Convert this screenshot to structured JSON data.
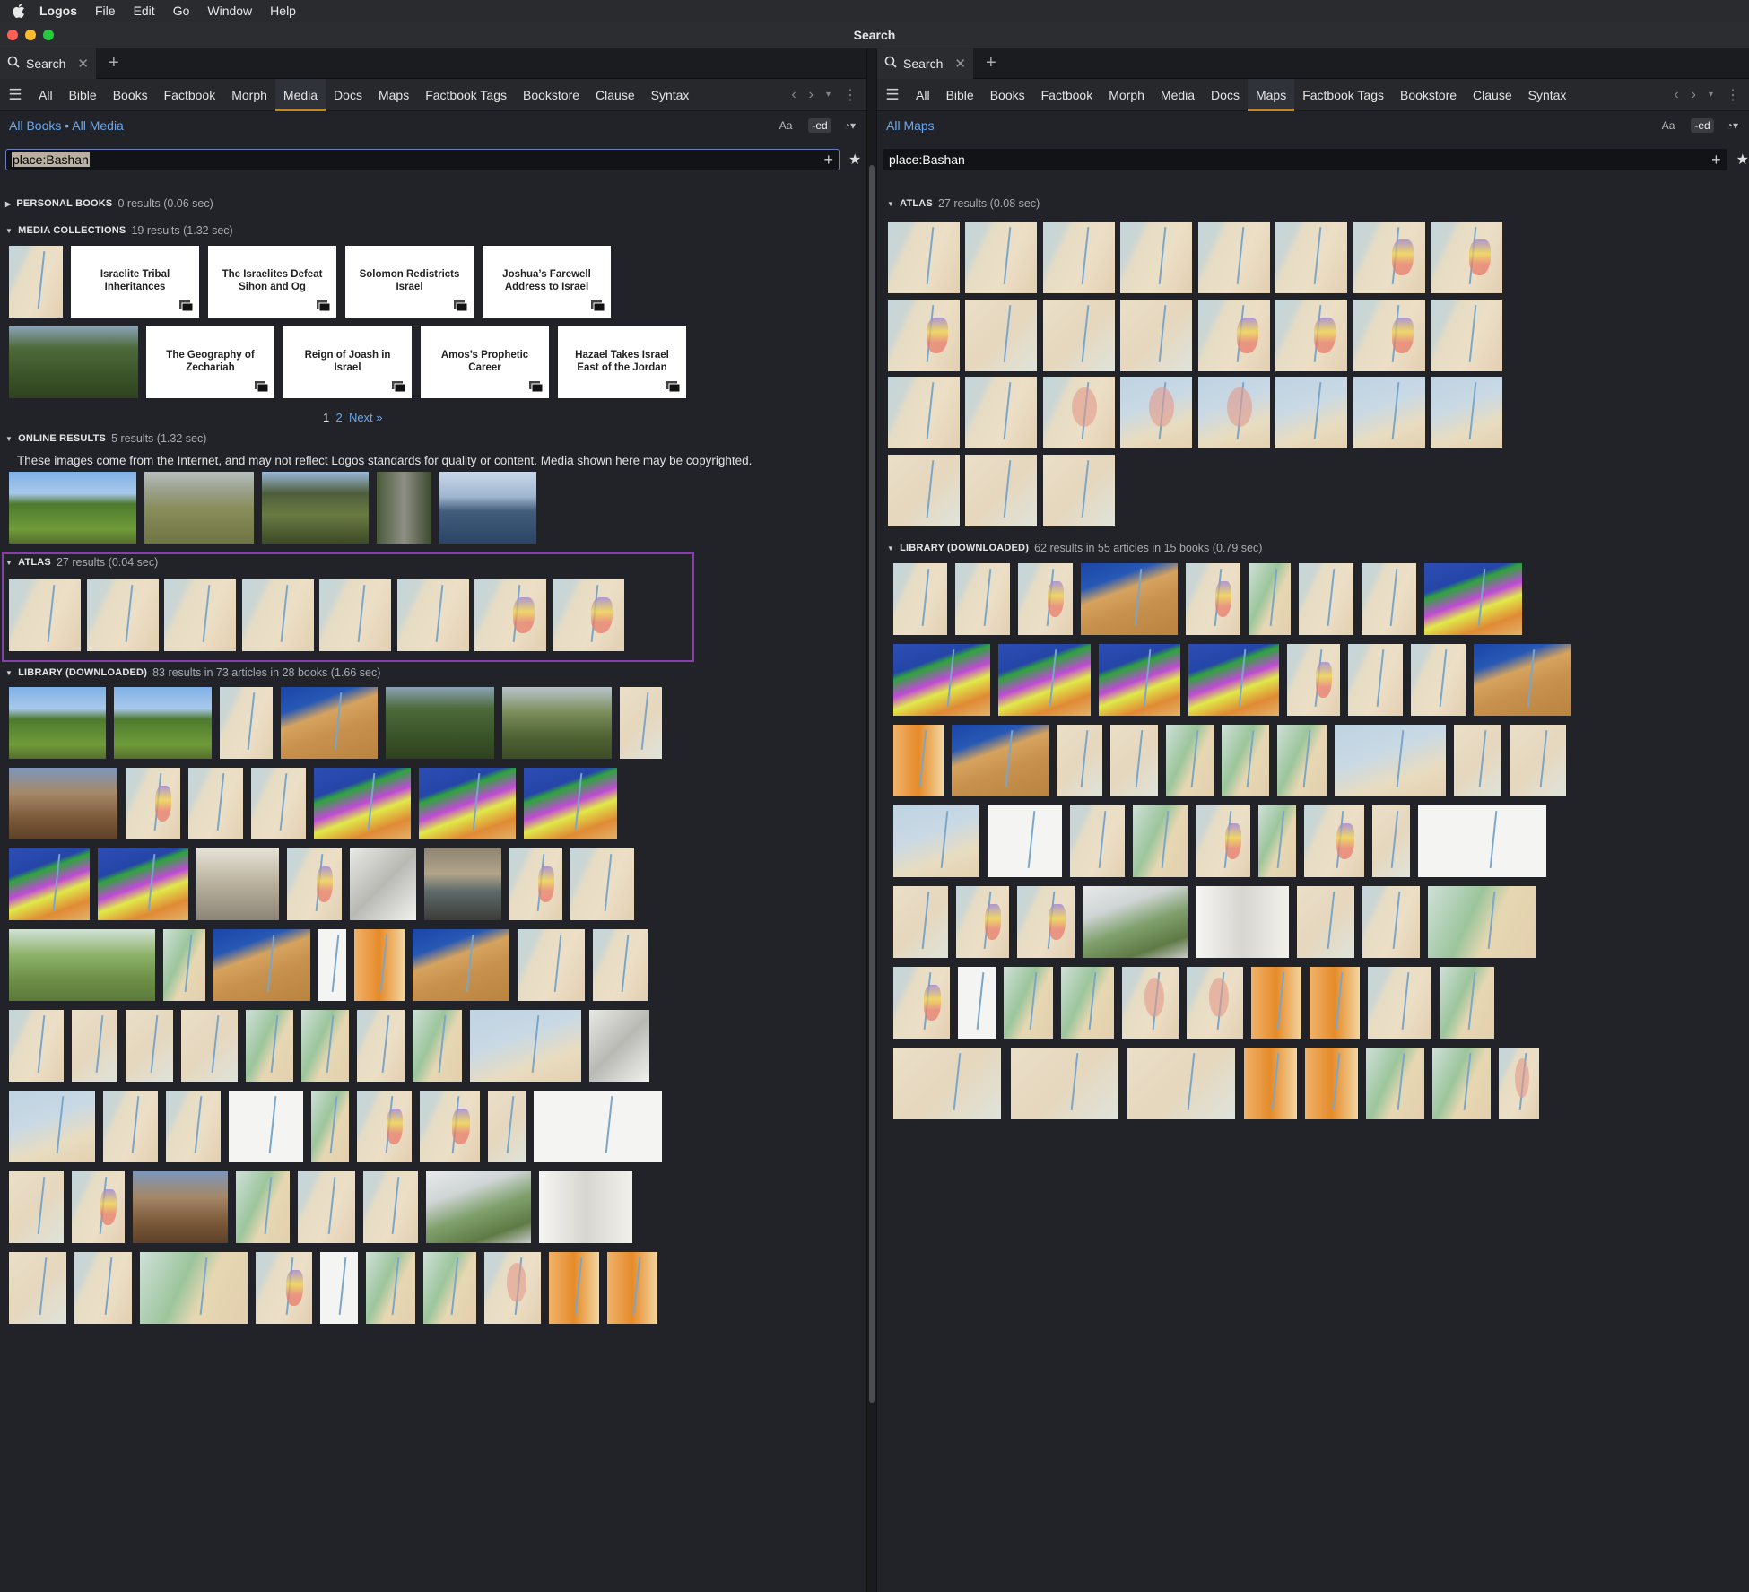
{
  "menubar": {
    "app_name": "Logos",
    "items": [
      "File",
      "Edit",
      "Go",
      "Window",
      "Help"
    ]
  },
  "window": {
    "title": "Search",
    "traffic_lights": [
      "#ff5f57",
      "#febc2e",
      "#28c840"
    ]
  },
  "left": {
    "tab": {
      "label": "Search",
      "close_icon": "close-icon"
    },
    "nav_tabs": [
      "All",
      "Bible",
      "Books",
      "Factbook",
      "Morph",
      "Media",
      "Docs",
      "Maps",
      "Factbook Tags",
      "Bookstore",
      "Clause",
      "Syntax"
    ],
    "active_tab": "Media",
    "scope": "All Books • All Media",
    "tools": {
      "aa": "Aa",
      "ed": "-ed"
    },
    "query": "place:Bashan",
    "sections": {
      "personal_books": {
        "label": "PERSONAL BOOKS",
        "count": "0 results (0.06 sec)"
      },
      "media_collections": {
        "label": "MEDIA COLLECTIONS",
        "count": "19 results (1.32 sec)",
        "cards": [
          "Israelite Tribal Inheritances",
          "The Israelites Defeat Sihon and Og",
          "Solomon Redistricts Israel",
          "Joshua’s Farewell Address to Israel",
          "The Geography of Zechariah",
          "Reign of Joash in Israel",
          "Amos’s Prophetic Career",
          "Hazael Takes Israel East of the Jordan"
        ],
        "pager": {
          "p1": "1",
          "p2": "2",
          "next": "Next »"
        }
      },
      "online_results": {
        "label": "ONLINE RESULTS",
        "count": "5 results (1.32 sec)",
        "notice": "These images come from the Internet, and may not reflect Logos standards for quality or content. Media shown here may be copyrighted."
      },
      "atlas": {
        "label": "ATLAS",
        "count": "27 results (0.04 sec)"
      },
      "library": {
        "label": "LIBRARY (DOWNLOADED)",
        "count": "83 results in 73 articles in 28 books (1.66 sec)"
      }
    }
  },
  "right": {
    "tab": {
      "label": "Search",
      "close_icon": "close-icon"
    },
    "nav_tabs": [
      "All",
      "Bible",
      "Books",
      "Factbook",
      "Morph",
      "Media",
      "Docs",
      "Maps",
      "Factbook Tags",
      "Bookstore",
      "Clause",
      "Syntax"
    ],
    "active_tab": "Maps",
    "scope": "All Maps",
    "tools": {
      "aa": "Aa",
      "ed": "-ed"
    },
    "query": "place:Bashan",
    "sections": {
      "atlas": {
        "label": "ATLAS",
        "count": "27 results (0.08 sec)"
      },
      "library": {
        "label": "LIBRARY (DOWNLOADED)",
        "count": "62 results in 55 articles in 15 books (0.79 sec)"
      }
    }
  },
  "colors": {
    "accent_tab": "#c7891d",
    "link": "#69a7ef",
    "atlas_highlight": "#8a3dad"
  }
}
